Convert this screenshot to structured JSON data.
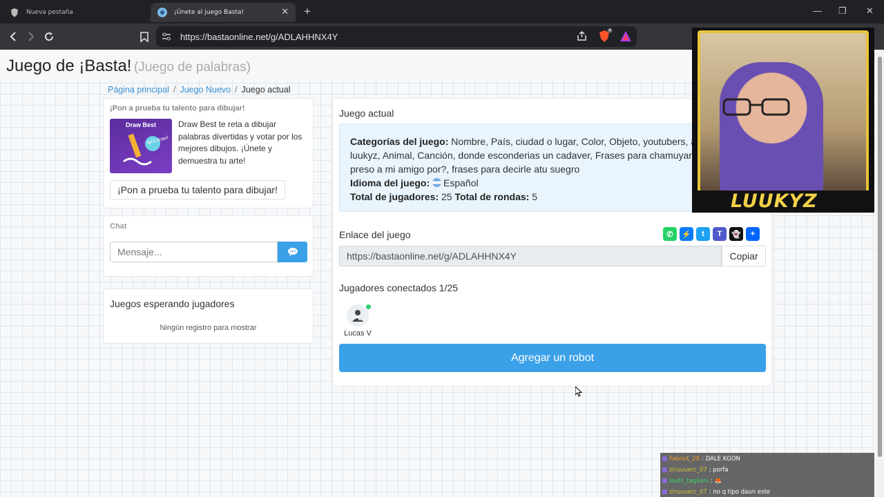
{
  "browser": {
    "tabs": [
      {
        "title": "Nueva pestaña",
        "active": false
      },
      {
        "title": "¡Únete al juego Basta!",
        "active": true
      }
    ],
    "url": "https://bastaonline.net/g/ADLAHHNX4Y",
    "brave_badge": "4"
  },
  "header": {
    "title": "Juego de ¡Basta!",
    "subtitle": "(Juego de palabras)"
  },
  "breadcrumb": {
    "home": "Página principal",
    "new_game": "Juego Nuevo",
    "current": "Juego actual",
    "sep": "/"
  },
  "promo": {
    "heading": "¡Pon a prueba tu talento para dibujar!",
    "image_title": "Draw Best",
    "image_tagline": "let's draw!",
    "text": "Draw Best te reta a dibujar palabras divertidas y votar por los mejores dibujos. ¡Únete y demuestra tu arte!",
    "button": "¡Pon a prueba tu talento para dibujar!"
  },
  "chat": {
    "heading": "Chat",
    "placeholder": "Mensaje..."
  },
  "waiting": {
    "heading": "Juegos esperando jugadores",
    "empty": "Ningún registro para mostrar"
  },
  "game": {
    "title": "Juego actual",
    "categories_label": "Categorías del juego:",
    "categories": "Nombre, País, ciudad o lugar, Color, Objeto, youtubers, ai luukyz, Animal, Canción, donde esconderias un cadaver, Frases para chamuyar, preso a mi amigo por?, frases para decirle atu suegro",
    "language_label": "Idioma del juego:",
    "language": "Español",
    "players_label": "Total de jugadores:",
    "players_total": "25",
    "rounds_label": "Total de rondas:",
    "rounds_total": "5",
    "link_heading": "Enlace del juego",
    "link": "https://bastaonline.net/g/ADLAHHNX4Y",
    "copy": "Copiar",
    "connected": "Jugadores conectados 1/25",
    "player_name": "Lucas V",
    "robot_button": "Agregar un robot"
  },
  "share_icons": [
    {
      "name": "whatsapp-icon",
      "color": "#25d366",
      "glyph": "✆"
    },
    {
      "name": "messenger-icon",
      "color": "#0a7cff",
      "glyph": "⚡"
    },
    {
      "name": "twitter-icon",
      "color": "#1da1f2",
      "glyph": "t"
    },
    {
      "name": "teams-icon",
      "color": "#5059c9",
      "glyph": "T"
    },
    {
      "name": "snapchat-icon",
      "color": "#111111",
      "glyph": "👻"
    },
    {
      "name": "share-plus-icon",
      "color": "#0166ff",
      "glyph": "+"
    }
  ],
  "stream": {
    "name": "LUUKYZ"
  },
  "stream_chat": [
    {
      "user": "FabroX_28",
      "color": "#f0a030",
      "text": ": DALE KGON"
    },
    {
      "user": "ziruuuerc_07",
      "color": "#d6c23a",
      "text": ": porfa"
    },
    {
      "user": "lautii_tagliani",
      "color": "#3ad66a",
      "text": ": 🦊"
    },
    {
      "user": "ziruuuerc_07",
      "color": "#d6c23a",
      "text": ": no q tipo daun este"
    }
  ]
}
